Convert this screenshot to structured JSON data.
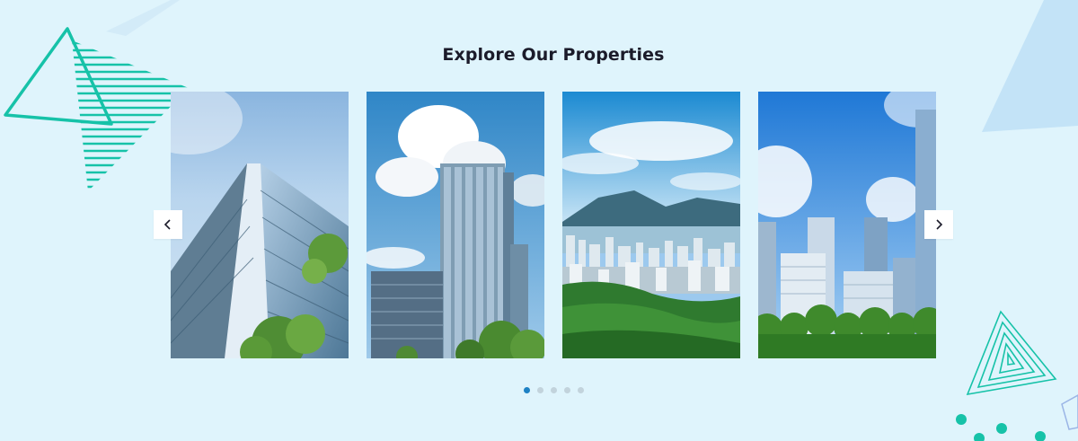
{
  "section": {
    "title": "Explore Our Properties"
  },
  "carousel": {
    "slides": [
      {
        "name": "glass-tower-low-angle"
      },
      {
        "name": "skyscraper-clouds"
      },
      {
        "name": "city-mountain-view"
      },
      {
        "name": "business-district"
      }
    ],
    "prev_icon": "chevron-left-icon",
    "next_icon": "chevron-right-icon",
    "dot_count": 5,
    "active_dot": 1
  },
  "colors": {
    "background": "#dff4fc",
    "accent_teal": "#16c2a8",
    "dot_active": "#1d81c4",
    "dot_inactive": "#c2d3dc"
  }
}
